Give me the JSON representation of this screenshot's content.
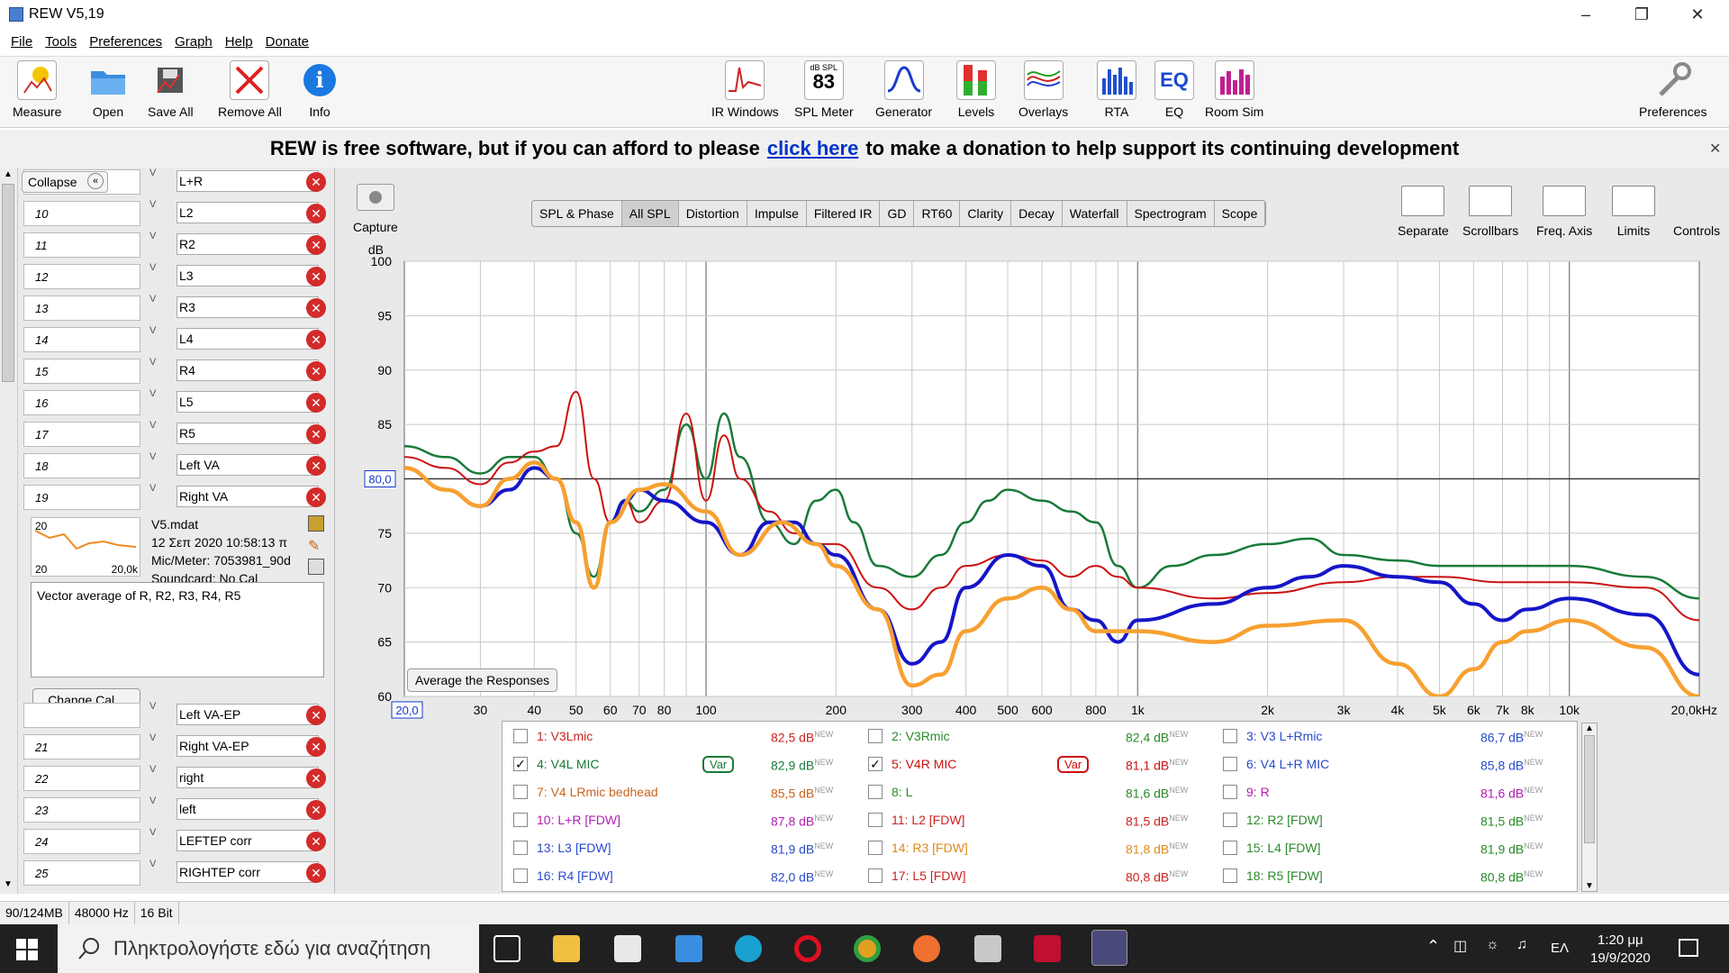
{
  "window": {
    "title": "REW V5,19"
  },
  "menu": [
    "File",
    "Tools",
    "Preferences",
    "Graph",
    "Help",
    "Donate"
  ],
  "toolbar_left": [
    "Measure",
    "Open",
    "Save All",
    "Remove All",
    "Info"
  ],
  "toolbar_center": [
    "IR Windows",
    "SPL Meter",
    "Generator",
    "Levels",
    "Overlays",
    "RTA",
    "EQ",
    "Room Sim"
  ],
  "spl_meter_value": "83",
  "spl_meter_unit": "dB SPL",
  "toolbar_right": "Preferences",
  "banner": {
    "pre": "REW is free software, but if you can afford to please",
    "link": "click here",
    "post": "to make a donation to help support its continuing development"
  },
  "left_panel": {
    "collapse_label": "Collapse",
    "measurements_top": [
      {
        "num": "",
        "name": "L+R"
      },
      {
        "num": "10",
        "name": "L2"
      },
      {
        "num": "11",
        "name": "R2"
      },
      {
        "num": "12",
        "name": "L3"
      },
      {
        "num": "13",
        "name": "R3"
      },
      {
        "num": "14",
        "name": "L4"
      },
      {
        "num": "15",
        "name": "R4"
      },
      {
        "num": "16",
        "name": "L5"
      },
      {
        "num": "17",
        "name": "R5"
      },
      {
        "num": "18",
        "name": "Left VA"
      },
      {
        "num": "19",
        "name": "Right VA"
      }
    ],
    "selected": {
      "num": "20",
      "file": "V5.mdat",
      "date": "12 Σεπ 2020 10:58:13 π",
      "mic": "Mic/Meter: 7053981_90d",
      "soundcard": "Soundcard: No Cal",
      "thumb_min": "20",
      "thumb_max": "20,0k",
      "notes": "Vector average of R, R2, R3, R4, R5",
      "change_cal": "Change Cal..."
    },
    "measurements_bottom": [
      {
        "num": "",
        "name": "Left VA-EP"
      },
      {
        "num": "21",
        "name": "Right VA-EP"
      },
      {
        "num": "22",
        "name": "right"
      },
      {
        "num": "23",
        "name": "left"
      },
      {
        "num": "24",
        "name": "LEFTEP corr"
      },
      {
        "num": "25",
        "name": "RIGHTEP corr"
      }
    ]
  },
  "capture_label": "Capture",
  "graph_tabs": [
    "SPL & Phase",
    "All SPL",
    "Distortion",
    "Impulse",
    "Filtered IR",
    "GD",
    "RT60",
    "Clarity",
    "Decay",
    "Waterfall",
    "Spectrogram",
    "Scope"
  ],
  "active_tab": "All SPL",
  "graph_tools": [
    "Separate",
    "Scrollbars",
    "Freq. Axis",
    "Limits",
    "Controls"
  ],
  "average_button": "Average the Responses",
  "cursor": {
    "y_value": "80,0",
    "x_value": "20,0"
  },
  "chart_data": {
    "type": "line",
    "ylabel": "dB",
    "y_ticks": [
      "100",
      "95",
      "90",
      "85",
      "80",
      "75",
      "70",
      "65",
      "60"
    ],
    "ylim": [
      60,
      100
    ],
    "x_scale": "log",
    "xlim": [
      20,
      20000
    ],
    "x_ticks": [
      {
        "v": 30,
        "l": "30"
      },
      {
        "v": 40,
        "l": "40"
      },
      {
        "v": 50,
        "l": "50"
      },
      {
        "v": 60,
        "l": "60"
      },
      {
        "v": 70,
        "l": "70"
      },
      {
        "v": 80,
        "l": "80"
      },
      {
        "v": 100,
        "l": "100"
      },
      {
        "v": 200,
        "l": "200"
      },
      {
        "v": 300,
        "l": "300"
      },
      {
        "v": 400,
        "l": "400"
      },
      {
        "v": 500,
        "l": "500"
      },
      {
        "v": 600,
        "l": "600"
      },
      {
        "v": 800,
        "l": "800"
      },
      {
        "v": 1000,
        "l": "1k"
      },
      {
        "v": 2000,
        "l": "2k"
      },
      {
        "v": 3000,
        "l": "3k"
      },
      {
        "v": 4000,
        "l": "4k"
      },
      {
        "v": 5000,
        "l": "5k"
      },
      {
        "v": 6000,
        "l": "6k"
      },
      {
        "v": 7000,
        "l": "7k"
      },
      {
        "v": 8000,
        "l": "8k"
      },
      {
        "v": 10000,
        "l": "10k"
      },
      {
        "v": 20000,
        "l": "20,0kHz"
      }
    ],
    "reference_y": 80,
    "series": [
      {
        "name": "4: V4L MIC",
        "color": "#1a7a3a",
        "width": 2.5,
        "points": [
          [
            20,
            83
          ],
          [
            25,
            82
          ],
          [
            30,
            80.5
          ],
          [
            35,
            82
          ],
          [
            40,
            82
          ],
          [
            45,
            80
          ],
          [
            50,
            75
          ],
          [
            55,
            71
          ],
          [
            60,
            76
          ],
          [
            65,
            78
          ],
          [
            70,
            77
          ],
          [
            80,
            79
          ],
          [
            90,
            85
          ],
          [
            100,
            80
          ],
          [
            110,
            86
          ],
          [
            120,
            82
          ],
          [
            140,
            76
          ],
          [
            160,
            74
          ],
          [
            180,
            78
          ],
          [
            200,
            79
          ],
          [
            220,
            76
          ],
          [
            250,
            72
          ],
          [
            300,
            71
          ],
          [
            350,
            73
          ],
          [
            400,
            76
          ],
          [
            450,
            78
          ],
          [
            500,
            79
          ],
          [
            600,
            78
          ],
          [
            700,
            77
          ],
          [
            800,
            76
          ],
          [
            900,
            72
          ],
          [
            1000,
            70
          ],
          [
            1200,
            72
          ],
          [
            1500,
            73
          ],
          [
            2000,
            74
          ],
          [
            2500,
            74.5
          ],
          [
            3000,
            73
          ],
          [
            4000,
            72.5
          ],
          [
            5000,
            72
          ],
          [
            7000,
            72
          ],
          [
            10000,
            72
          ],
          [
            15000,
            71
          ],
          [
            20000,
            69
          ]
        ]
      },
      {
        "name": "5: V4R MIC",
        "color": "#cc1111",
        "width": 2,
        "points": [
          [
            20,
            82
          ],
          [
            25,
            81
          ],
          [
            30,
            79.5
          ],
          [
            35,
            81.5
          ],
          [
            40,
            82.5
          ],
          [
            45,
            83
          ],
          [
            50,
            88
          ],
          [
            55,
            80
          ],
          [
            60,
            76
          ],
          [
            65,
            78
          ],
          [
            70,
            76
          ],
          [
            80,
            78
          ],
          [
            90,
            86
          ],
          [
            100,
            78
          ],
          [
            110,
            84
          ],
          [
            120,
            80
          ],
          [
            140,
            77
          ],
          [
            160,
            75
          ],
          [
            180,
            74
          ],
          [
            200,
            74
          ],
          [
            250,
            70
          ],
          [
            300,
            68
          ],
          [
            350,
            70
          ],
          [
            400,
            72
          ],
          [
            500,
            73
          ],
          [
            600,
            72.5
          ],
          [
            700,
            71
          ],
          [
            800,
            72
          ],
          [
            900,
            71
          ],
          [
            1000,
            70
          ],
          [
            1500,
            69
          ],
          [
            2000,
            69.5
          ],
          [
            3000,
            70.5
          ],
          [
            4000,
            71
          ],
          [
            5000,
            71
          ],
          [
            7000,
            70.5
          ],
          [
            10000,
            70.5
          ],
          [
            15000,
            70
          ],
          [
            20000,
            67
          ]
        ]
      },
      {
        "name": "Blue",
        "color": "#1515c8",
        "width": 4,
        "points": [
          [
            20,
            81
          ],
          [
            25,
            79
          ],
          [
            30,
            77.5
          ],
          [
            35,
            79
          ],
          [
            40,
            81
          ],
          [
            45,
            80
          ],
          [
            50,
            76
          ],
          [
            55,
            70
          ],
          [
            60,
            76
          ],
          [
            65,
            78
          ],
          [
            70,
            79
          ],
          [
            80,
            78
          ],
          [
            100,
            76
          ],
          [
            120,
            73
          ],
          [
            140,
            76
          ],
          [
            160,
            76
          ],
          [
            180,
            74
          ],
          [
            200,
            73
          ],
          [
            250,
            68
          ],
          [
            300,
            63
          ],
          [
            350,
            65
          ],
          [
            400,
            70
          ],
          [
            500,
            73
          ],
          [
            600,
            72
          ],
          [
            700,
            68
          ],
          [
            800,
            67
          ],
          [
            900,
            65
          ],
          [
            1000,
            67
          ],
          [
            1500,
            68.5
          ],
          [
            2000,
            70
          ],
          [
            2500,
            71
          ],
          [
            3000,
            72
          ],
          [
            4000,
            71
          ],
          [
            5000,
            70.5
          ],
          [
            6000,
            68.5
          ],
          [
            7000,
            67
          ],
          [
            8000,
            68
          ],
          [
            10000,
            69
          ],
          [
            15000,
            67.5
          ],
          [
            20000,
            62
          ]
        ]
      },
      {
        "name": "Orange",
        "color": "#f7a030",
        "width": 4.5,
        "points": [
          [
            20,
            81
          ],
          [
            25,
            79
          ],
          [
            30,
            77.5
          ],
          [
            35,
            80
          ],
          [
            40,
            81.5
          ],
          [
            45,
            80
          ],
          [
            50,
            76
          ],
          [
            55,
            70
          ],
          [
            60,
            76
          ],
          [
            70,
            79
          ],
          [
            80,
            79.5
          ],
          [
            100,
            77
          ],
          [
            120,
            73
          ],
          [
            150,
            76
          ],
          [
            180,
            74
          ],
          [
            200,
            72
          ],
          [
            250,
            68
          ],
          [
            300,
            61
          ],
          [
            350,
            62
          ],
          [
            400,
            66
          ],
          [
            500,
            69
          ],
          [
            600,
            70
          ],
          [
            700,
            68
          ],
          [
            800,
            66
          ],
          [
            1000,
            66
          ],
          [
            1500,
            65
          ],
          [
            2000,
            66.5
          ],
          [
            3000,
            67
          ],
          [
            4000,
            63
          ],
          [
            5000,
            60
          ],
          [
            6000,
            62.5
          ],
          [
            7000,
            65
          ],
          [
            8000,
            66
          ],
          [
            10000,
            67
          ],
          [
            15000,
            64.5
          ],
          [
            20000,
            60
          ]
        ]
      }
    ]
  },
  "legend": [
    {
      "label": "1: V3Lmic",
      "value": "82,5 dB",
      "checked": false,
      "color": "#cc2222"
    },
    {
      "label": "2: V3Rmic",
      "value": "82,4 dB",
      "checked": false,
      "color": "#2a8a2a"
    },
    {
      "label": "3: V3 L+Rmic",
      "value": "86,7 dB",
      "checked": false,
      "color": "#2a4acc"
    },
    {
      "label": "4: V4L  MIC",
      "value": "82,9 dB",
      "checked": true,
      "color": "#1a7a3a",
      "var": true
    },
    {
      "label": "5: V4R MIC",
      "value": "81,1 dB",
      "checked": true,
      "color": "#cc1111",
      "var": true
    },
    {
      "label": "6: V4 L+R MIC",
      "value": "85,8 dB",
      "checked": false,
      "color": "#2a4acc"
    },
    {
      "label": "7: V4 LRmic bedhead",
      "value": "85,5 dB",
      "checked": false,
      "color": "#c8641e"
    },
    {
      "label": "8: L",
      "value": "81,6 dB",
      "checked": false,
      "color": "#2a8a2a"
    },
    {
      "label": "9: R",
      "value": "81,6 dB",
      "checked": false,
      "color": "#b020b0"
    },
    {
      "label": "10: L+R [FDW]",
      "value": "87,8 dB",
      "checked": false,
      "color": "#b020b0"
    },
    {
      "label": "11: L2 [FDW]",
      "value": "81,5 dB",
      "checked": false,
      "color": "#cc2222"
    },
    {
      "label": "12: R2 [FDW]",
      "value": "81,5 dB",
      "checked": false,
      "color": "#2a8a2a"
    },
    {
      "label": "13: L3 [FDW]",
      "value": "81,9 dB",
      "checked": false,
      "color": "#2a4acc"
    },
    {
      "label": "14: R3 [FDW]",
      "value": "81,8 dB",
      "checked": false,
      "color": "#e08a18"
    },
    {
      "label": "15: L4 [FDW]",
      "value": "81,9 dB",
      "checked": false,
      "color": "#2a8a2a"
    },
    {
      "label": "16: R4 [FDW]",
      "value": "82,0 dB",
      "checked": false,
      "color": "#2a4acc"
    },
    {
      "label": "17: L5 [FDW]",
      "value": "80,8 dB",
      "checked": false,
      "color": "#cc2222"
    },
    {
      "label": "18: R5 [FDW]",
      "value": "80,8 dB",
      "checked": false,
      "color": "#2a8a2a"
    }
  ],
  "legend_new": "NEW",
  "var_label": "Var",
  "status": [
    "90/124MB",
    "48000 Hz",
    "16 Bit"
  ],
  "taskbar": {
    "search_placeholder": "Πληκτρολογήστε εδώ για αναζήτηση",
    "lang": "ΕΛ",
    "time": "1:20 μμ",
    "date": "19/9/2020"
  }
}
